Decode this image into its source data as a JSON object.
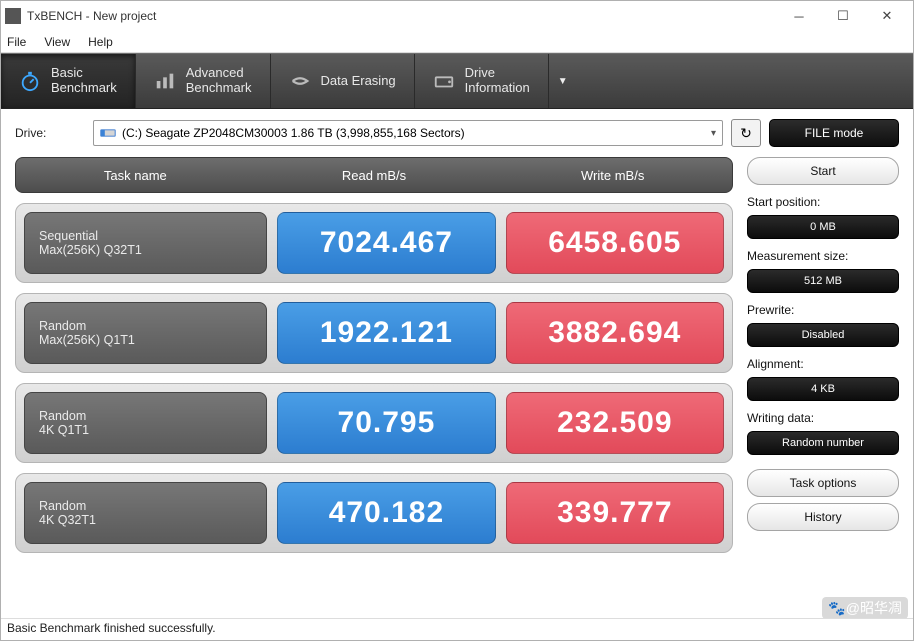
{
  "window": {
    "title": "TxBENCH - New project"
  },
  "menu": {
    "file": "File",
    "view": "View",
    "help": "Help"
  },
  "tabs": {
    "basic": {
      "l1": "Basic",
      "l2": "Benchmark"
    },
    "advanced": {
      "l1": "Advanced",
      "l2": "Benchmark"
    },
    "erase": {
      "l1": "Data Erasing"
    },
    "info": {
      "l1": "Drive",
      "l2": "Information"
    }
  },
  "toprow": {
    "drive_label": "Drive:",
    "drive_text": "(C:) Seagate ZP2048CM30003   1.86 TB (3,998,855,168 Sectors)",
    "filemode": "FILE mode"
  },
  "headers": {
    "task": "Task name",
    "read": "Read mB/s",
    "write": "Write mB/s"
  },
  "rows": [
    {
      "t1": "Sequential",
      "t2": "Max(256K) Q32T1",
      "read": "7024.467",
      "write": "6458.605"
    },
    {
      "t1": "Random",
      "t2": "Max(256K) Q1T1",
      "read": "1922.121",
      "write": "3882.694"
    },
    {
      "t1": "Random",
      "t2": "4K Q1T1",
      "read": "70.795",
      "write": "232.509"
    },
    {
      "t1": "Random",
      "t2": "4K Q32T1",
      "read": "470.182",
      "write": "339.777"
    }
  ],
  "side": {
    "start": "Start",
    "start_pos_label": "Start position:",
    "start_pos_val": "0 MB",
    "meas_label": "Measurement size:",
    "meas_val": "512 MB",
    "prewrite_label": "Prewrite:",
    "prewrite_val": "Disabled",
    "align_label": "Alignment:",
    "align_val": "4 KB",
    "writing_label": "Writing data:",
    "writing_val": "Random number",
    "task_options": "Task options",
    "history": "History"
  },
  "status": "Basic Benchmark finished successfully.",
  "watermark": "🐾@昭华凋"
}
